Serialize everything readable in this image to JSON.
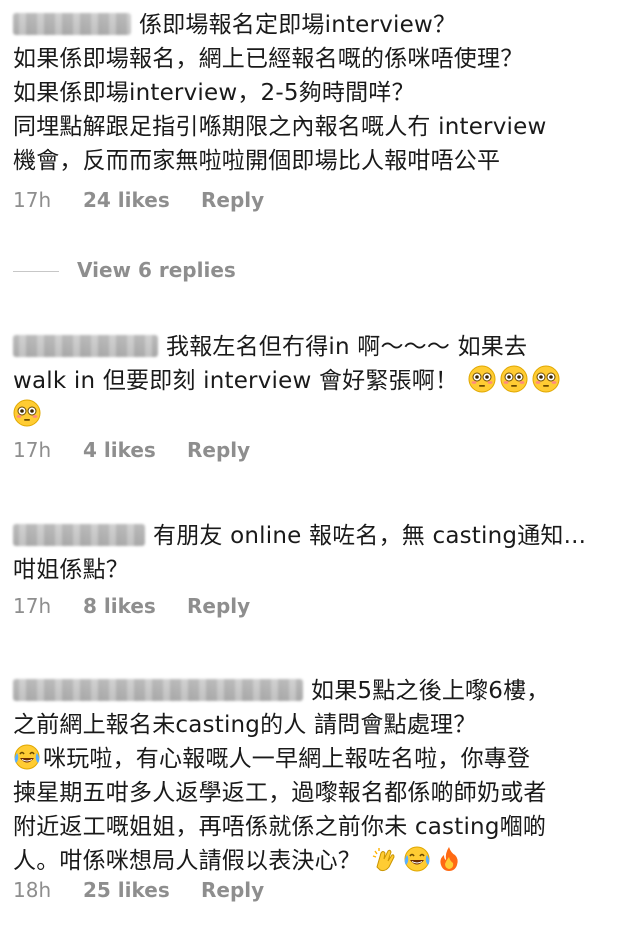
{
  "comments": [
    {
      "lines": [
        "係即場報名定即場interview？",
        "如果係即場報名，網上已經報名嘅的係咪唔使理？",
        "如果係即場interview，2-5夠時間咩？",
        "同埋點解跟足指引喺期限之內報名嘅人冇 interview",
        "機會，反而而家無啦啦開個即場比人報咁唔公平"
      ],
      "time": "17h",
      "likes": "24 likes",
      "reply": "Reply"
    },
    {
      "lines": [
        "我報左名但冇得in 啊～～～ 如果去",
        "walk in 但要即刻 interview 會好緊張啊！",
        ""
      ],
      "time": "17h",
      "likes": "4 likes",
      "reply": "Reply",
      "emojis": [
        "flushed-face",
        "flushed-face",
        "flushed-face",
        "flushed-face"
      ]
    },
    {
      "lines": [
        "有朋友 online 報咗名，無 casting通知...",
        "咁姐係點？"
      ],
      "time": "17h",
      "likes": "8 likes",
      "reply": "Reply"
    },
    {
      "lines": [
        "如果5點之後上嚟6樓，",
        "之前網上報名未casting的人 請問會點處理？",
        "咪玩啦，有心報嘅人一早網上報咗名啦，你專登",
        "揀星期五咁多人返學返工，過嚟報名都係啲師奶或者",
        "附近返工嘅姐姐，再唔係就係之前你未 casting嗰啲",
        "人。咁係咪想局人請假以表決心？"
      ],
      "time": "18h",
      "likes": "25 likes",
      "reply": "Reply",
      "emojis": [
        "tears-of-joy-face",
        "clapping-hands",
        "tears-of-joy-face",
        "fire"
      ]
    }
  ],
  "view_replies": "View 6 replies",
  "colors": {
    "text": "#1a1a1a",
    "meta": "#8e8e8e",
    "emoji_yellow": "#ffcc33",
    "fire": "#ff6a13"
  }
}
